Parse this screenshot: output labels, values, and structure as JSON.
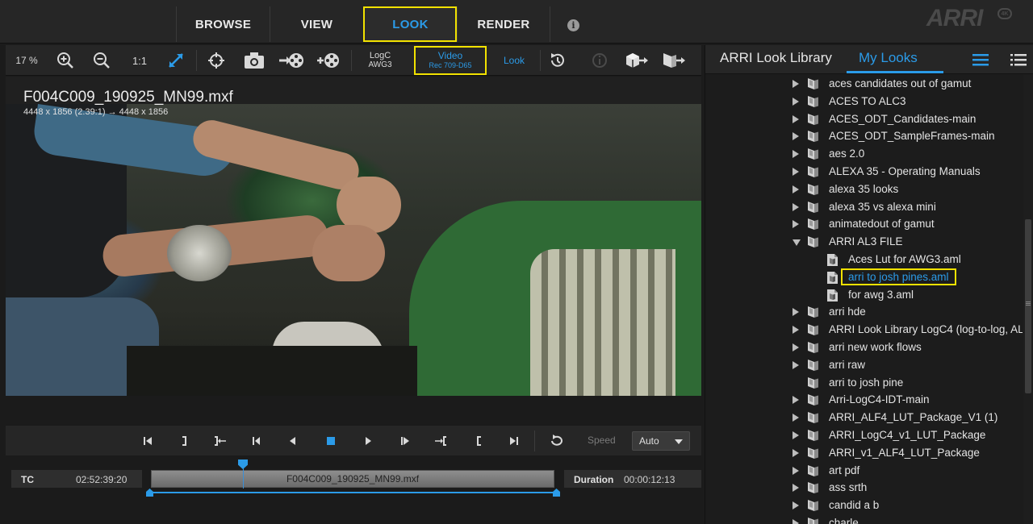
{
  "nav": {
    "tabs": [
      {
        "label": "BROWSE"
      },
      {
        "label": "VIEW"
      },
      {
        "label": "LOOK"
      },
      {
        "label": "RENDER"
      }
    ],
    "active_tab": "LOOK",
    "info_label": "i",
    "brand": "ARRI",
    "brand_mark": "4K"
  },
  "toolbar": {
    "zoom": "17 %",
    "one_to_one": "1:1",
    "input_cs": {
      "line1": "LogC",
      "line2": "AWG3"
    },
    "output_cs": {
      "line1": "Video",
      "line2": "Rec 709-D65"
    },
    "look_label": "Look"
  },
  "viewer": {
    "clip_name": "F004C009_190925_MN99.mxf",
    "resolution": "4448 x 1856 (2.39:1) → 4448 x 1856"
  },
  "transport": {
    "speed_label": "Speed",
    "speed_value": "Auto"
  },
  "timeline": {
    "tc_label": "TC",
    "tc_value": "02:52:39:20",
    "track_label": "F004C009_190925_MN99.mxf",
    "duration_label": "Duration",
    "duration_value": "00:00:12:13"
  },
  "panel": {
    "tab_library": "ARRI Look Library",
    "tab_my_looks": "My Looks",
    "active_tab": "My Looks",
    "items": [
      {
        "label": "aces candidates out of gamut",
        "level": 0,
        "type": "folder",
        "expanded": false
      },
      {
        "label": "ACES TO ALC3",
        "level": 0,
        "type": "folder",
        "expanded": false
      },
      {
        "label": "ACES_ODT_Candidates-main",
        "level": 0,
        "type": "folder",
        "expanded": false
      },
      {
        "label": "ACES_ODT_SampleFrames-main",
        "level": 0,
        "type": "folder",
        "expanded": false
      },
      {
        "label": "aes 2.0",
        "level": 0,
        "type": "folder",
        "expanded": false
      },
      {
        "label": "ALEXA 35 - Operating Manuals",
        "level": 0,
        "type": "folder",
        "expanded": false
      },
      {
        "label": "alexa 35 looks",
        "level": 0,
        "type": "folder",
        "expanded": false
      },
      {
        "label": "alexa 35 vs alexa mini",
        "level": 0,
        "type": "folder",
        "expanded": false
      },
      {
        "label": "animatedout of gamut",
        "level": 0,
        "type": "folder",
        "expanded": false
      },
      {
        "label": "ARRI AL3 FILE",
        "level": 0,
        "type": "folder",
        "expanded": true
      },
      {
        "label": "Aces Lut for AWG3.aml",
        "level": 1,
        "type": "file"
      },
      {
        "label": "arri to josh pines.aml",
        "level": 1,
        "type": "file",
        "selected": true
      },
      {
        "label": "for awg 3.aml",
        "level": 1,
        "type": "file"
      },
      {
        "label": "arri hde",
        "level": 0,
        "type": "folder",
        "expanded": false
      },
      {
        "label": "ARRI Look Library LogC4 (log-to-log, AL",
        "level": 0,
        "type": "folder",
        "expanded": false
      },
      {
        "label": "arri new work flows",
        "level": 0,
        "type": "folder",
        "expanded": false
      },
      {
        "label": "arri raw",
        "level": 0,
        "type": "folder",
        "expanded": false
      },
      {
        "label": "arri to josh pine",
        "level": 0,
        "type": "folder-noarrow"
      },
      {
        "label": "Arri-LogC4-IDT-main",
        "level": 0,
        "type": "folder",
        "expanded": false
      },
      {
        "label": "ARRI_ALF4_LUT_Package_V1 (1)",
        "level": 0,
        "type": "folder",
        "expanded": false
      },
      {
        "label": "ARRI_LogC4_v1_LUT_Package",
        "level": 0,
        "type": "folder",
        "expanded": false
      },
      {
        "label": "ARRI_v1_ALF4_LUT_Package",
        "level": 0,
        "type": "folder",
        "expanded": false
      },
      {
        "label": "art pdf",
        "level": 0,
        "type": "folder",
        "expanded": false
      },
      {
        "label": "ass srth",
        "level": 0,
        "type": "folder",
        "expanded": false
      },
      {
        "label": "candid a b",
        "level": 0,
        "type": "folder",
        "expanded": false
      },
      {
        "label": "charle",
        "level": 0,
        "type": "folder",
        "expanded": false
      }
    ]
  },
  "colors": {
    "accent": "#2b9be8",
    "highlight": "#f2e200",
    "background": "#1b1b1b",
    "panel": "#262626"
  }
}
